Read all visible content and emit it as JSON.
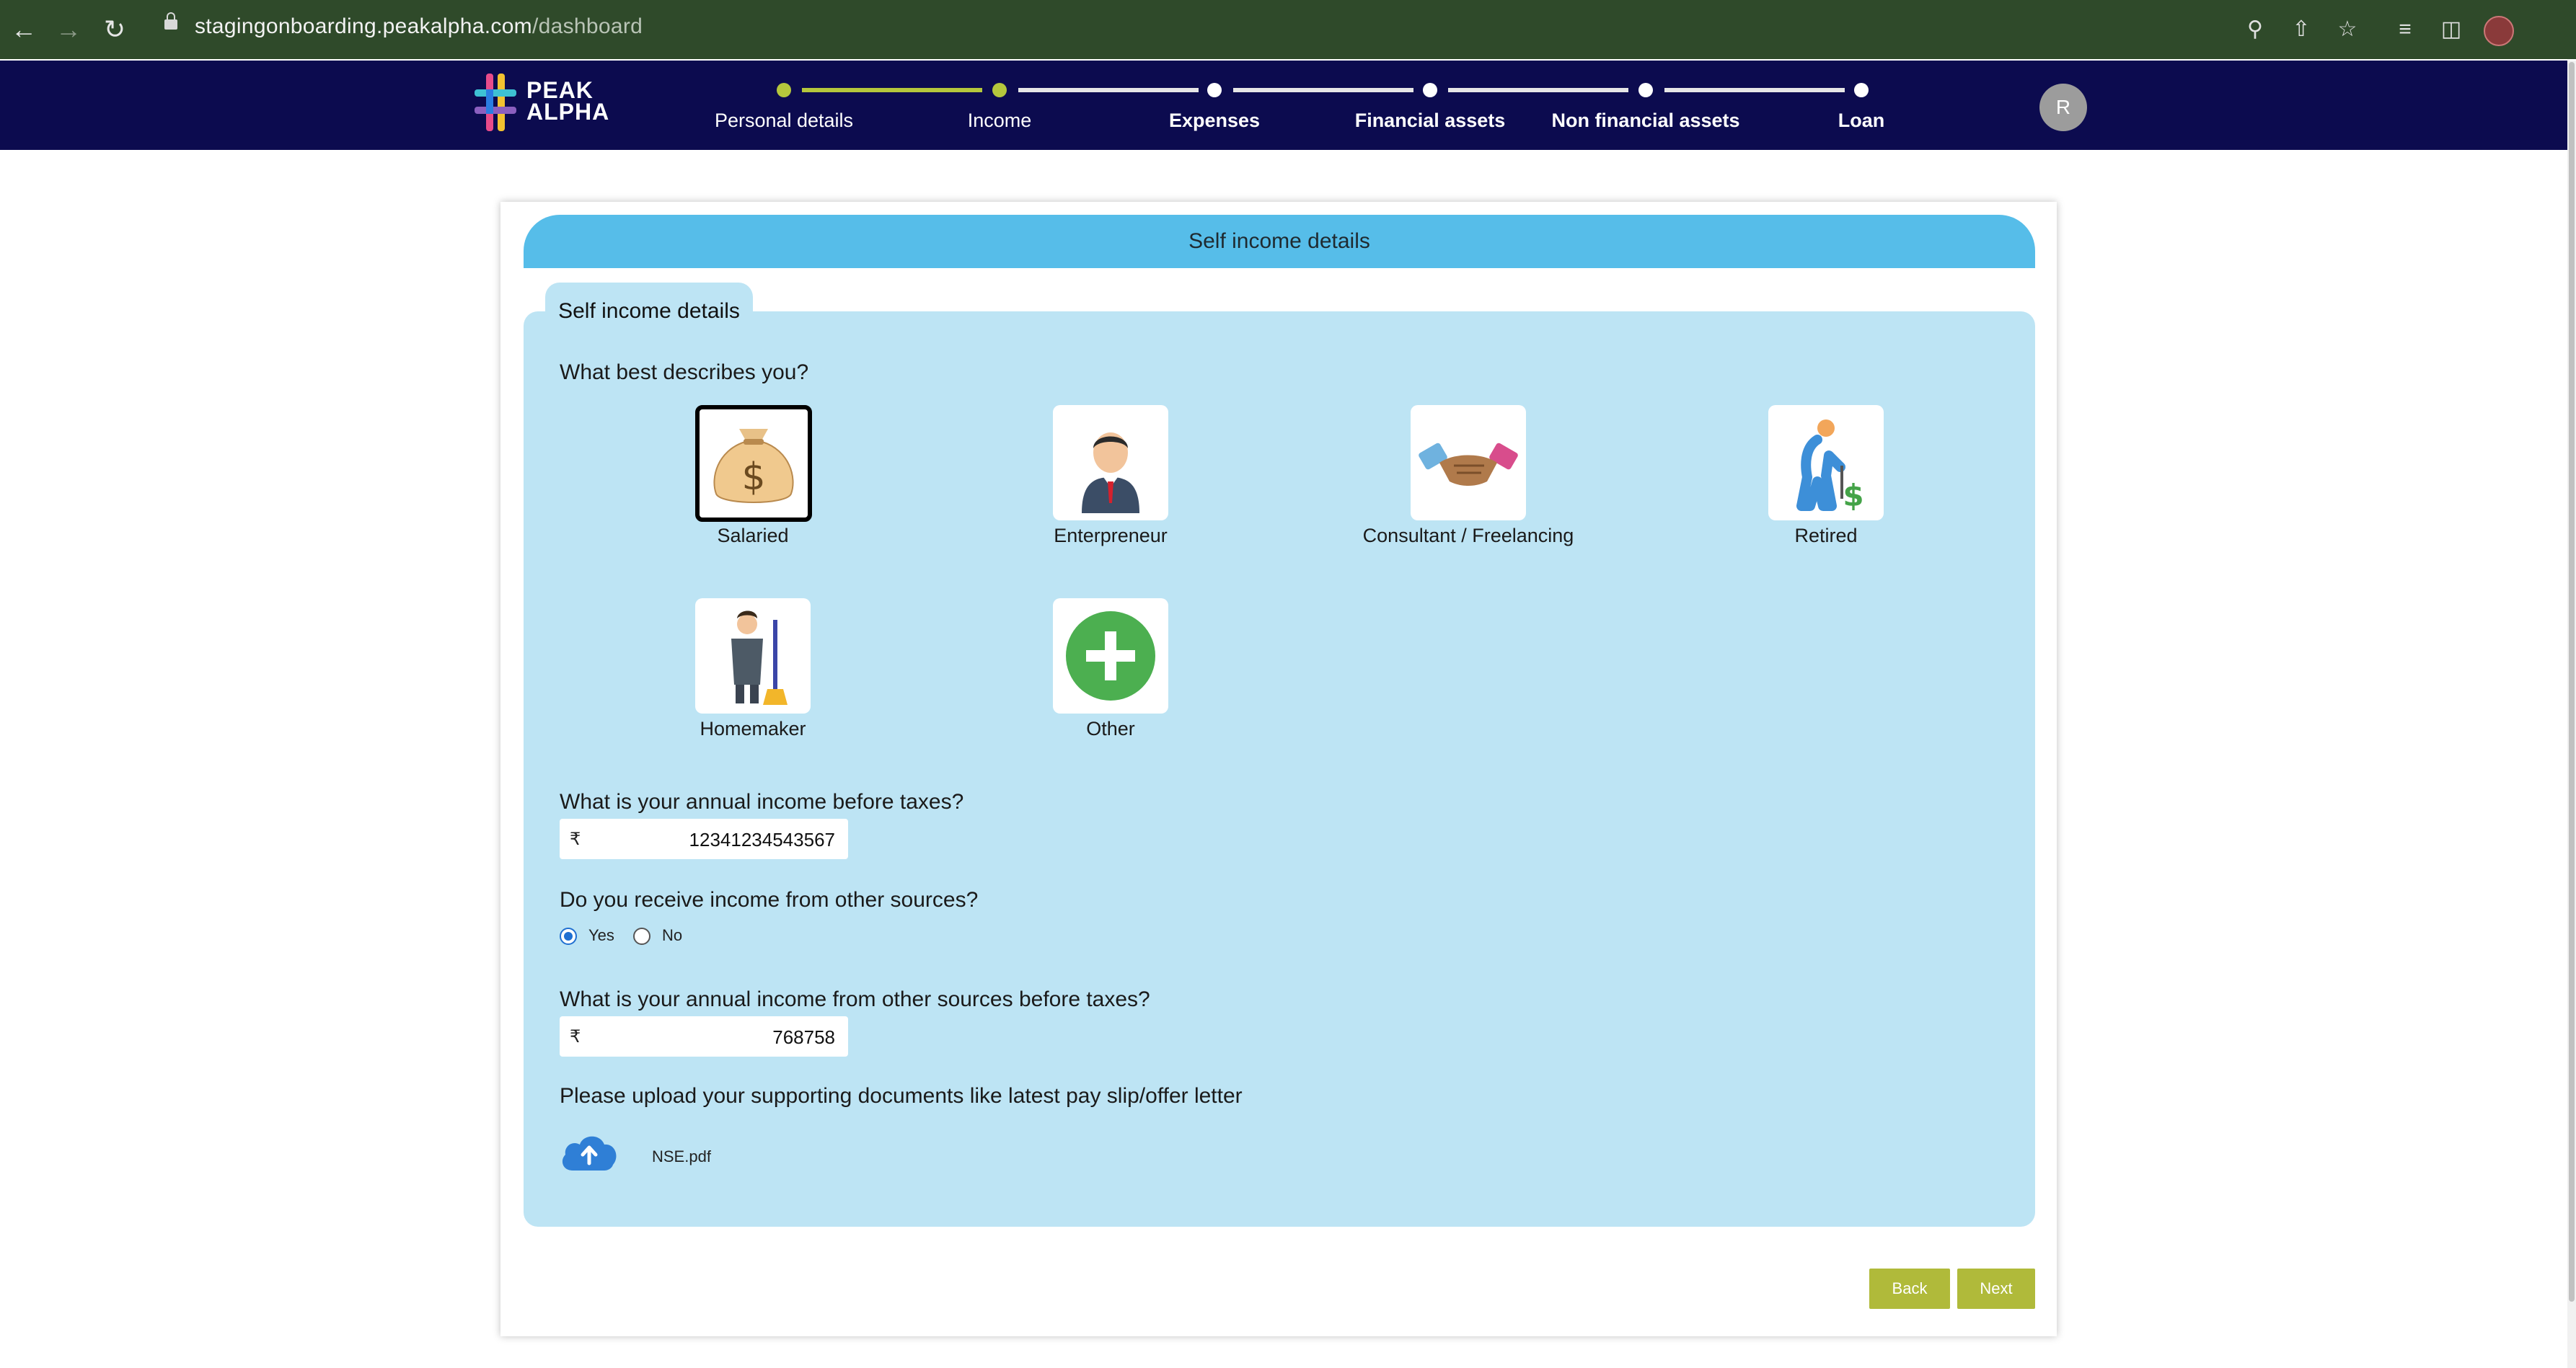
{
  "browser": {
    "url_host": "stagingonboarding.peakalpha.com",
    "url_path": "/dashboard"
  },
  "app": {
    "logo_line1": "PEAK",
    "logo_line2": "ALPHA",
    "avatar_initial": "R",
    "steps": [
      {
        "label": "Personal details",
        "status": "done"
      },
      {
        "label": "Income",
        "status": "current"
      },
      {
        "label": "Expenses",
        "status": "pending"
      },
      {
        "label": "Financial assets",
        "status": "pending"
      },
      {
        "label": "Non financial assets",
        "status": "pending"
      },
      {
        "label": "Loan",
        "status": "pending"
      }
    ],
    "accent": "#b5c73c",
    "header_bg": "#0c0b4f"
  },
  "form": {
    "header_title": "Self income details",
    "tab_label": "Self income details",
    "q_describe": "What best describes you?",
    "options": [
      {
        "label": "Salaried",
        "icon": "money-bag-icon",
        "selected": true
      },
      {
        "label": "Enterpreneur",
        "icon": "businessman-icon",
        "selected": false
      },
      {
        "label": "Consultant / Freelancing",
        "icon": "handshake-icon",
        "selected": false
      },
      {
        "label": "Retired",
        "icon": "elderly-person-icon",
        "selected": false
      },
      {
        "label": "Homemaker",
        "icon": "homemaker-broom-icon",
        "selected": false
      },
      {
        "label": "Other",
        "icon": "plus-icon",
        "selected": false
      }
    ],
    "q_annual_income": "What is your annual income before taxes?",
    "currency_symbol": "₹",
    "annual_income_value": "12341234543567",
    "q_other_sources": "Do you receive income from other sources?",
    "radio_yes": "Yes",
    "radio_no": "No",
    "other_sources_selected": "Yes",
    "q_other_income": "What is your annual income from other sources before taxes?",
    "other_income_value": "768758",
    "q_upload": "Please upload your supporting documents like latest pay slip/offer letter",
    "uploaded_file": "NSE.pdf",
    "back_label": "Back",
    "next_label": "Next"
  }
}
